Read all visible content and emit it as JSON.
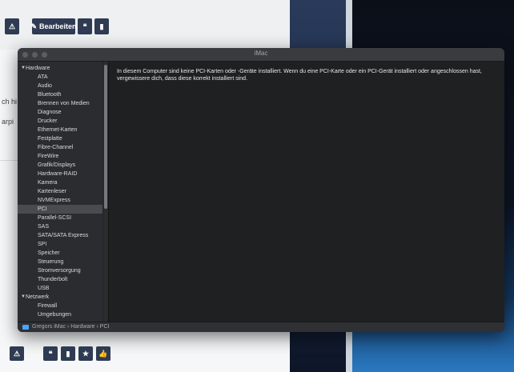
{
  "background": {
    "edit_button_label": "Bearbeiten",
    "side_text_1": "ch hi",
    "side_text_2": "arpi"
  },
  "window": {
    "title": "iMac",
    "sidebar": [
      {
        "label": "Hardware",
        "group": true
      },
      {
        "label": "ATA"
      },
      {
        "label": "Audio"
      },
      {
        "label": "Bluetooth"
      },
      {
        "label": "Brennen von Medien"
      },
      {
        "label": "Diagnose"
      },
      {
        "label": "Drucker"
      },
      {
        "label": "Ethernet-Karten"
      },
      {
        "label": "Festplatte"
      },
      {
        "label": "Fibre-Channel"
      },
      {
        "label": "FireWire"
      },
      {
        "label": "Grafik/Displays"
      },
      {
        "label": "Hardware-RAID"
      },
      {
        "label": "Kamera"
      },
      {
        "label": "Kartenleser"
      },
      {
        "label": "NVMExpress"
      },
      {
        "label": "PCI",
        "selected": true
      },
      {
        "label": "Parallel-SCSI"
      },
      {
        "label": "SAS"
      },
      {
        "label": "SATA/SATA Express"
      },
      {
        "label": "SPI"
      },
      {
        "label": "Speicher"
      },
      {
        "label": "Steuerung"
      },
      {
        "label": "Stromversorgung"
      },
      {
        "label": "Thunderbolt"
      },
      {
        "label": "USB"
      },
      {
        "label": "Netzwerk",
        "group": true
      },
      {
        "label": "Firewall"
      },
      {
        "label": "Umgebungen"
      }
    ],
    "message": "In diesem Computer sind keine PCI-Karten oder -Geräte installiert. Wenn du eine PCI-Karte oder ein PCI-Gerät installiert oder angeschlossen hast, vergewissere dich, dass diese korrekt installiert sind.",
    "status_path": "Gregors iMac › Hardware › PCI"
  }
}
